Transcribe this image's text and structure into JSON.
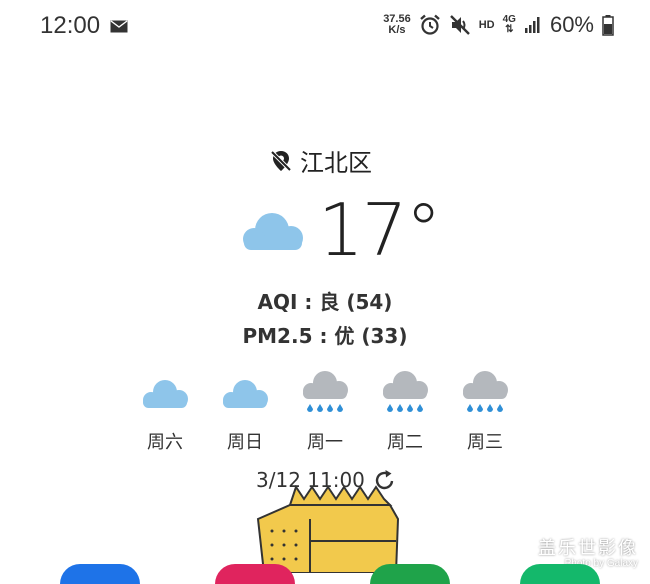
{
  "status_bar": {
    "time": "12:00",
    "net_speed_value": "37.56",
    "net_speed_unit": "K/s",
    "hd": "HD",
    "network": "4G",
    "battery": "60%"
  },
  "location": "江北区",
  "temperature": "17°",
  "aqi": "AQI : 良 (54)",
  "pm25": "PM2.5 : 优 (33)",
  "forecast": [
    {
      "day": "周六",
      "icon": "cloud-icon"
    },
    {
      "day": "周日",
      "icon": "cloud-icon"
    },
    {
      "day": "周一",
      "icon": "rain-icon"
    },
    {
      "day": "周二",
      "icon": "rain-icon"
    },
    {
      "day": "周三",
      "icon": "rain-icon"
    }
  ],
  "updated": "3/12 11:00",
  "watermark": {
    "title": "盖乐世影像",
    "subtitle": "Photo by Galaxy"
  },
  "colors": {
    "cloud": "#8ec5ea",
    "rain_cloud": "#b4b8bd",
    "rain_drop": "#2f8fd6",
    "text": "#222222"
  }
}
